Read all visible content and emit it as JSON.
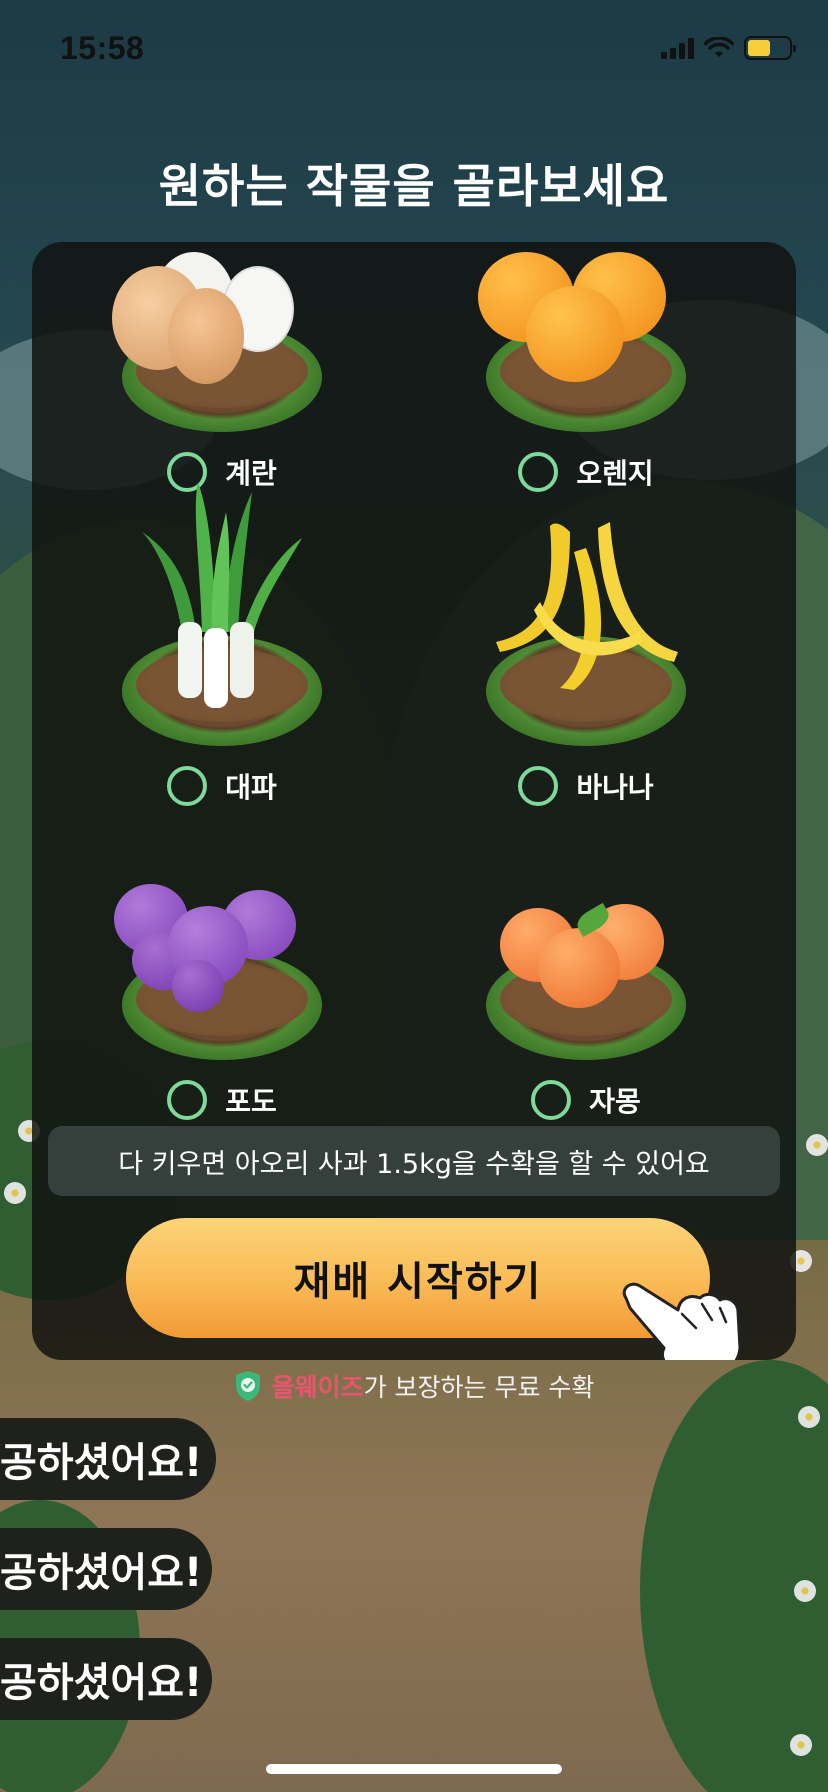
{
  "status_bar": {
    "time": "15:58",
    "battery_color": "#f5cd3d"
  },
  "page": {
    "title": "원하는 작물을 골라보세요"
  },
  "crops": [
    {
      "label": "계란",
      "icon": "egg-icon",
      "selected": false
    },
    {
      "label": "오렌지",
      "icon": "orange-icon",
      "selected": false
    },
    {
      "label": "대파",
      "icon": "green-onion-icon",
      "selected": false
    },
    {
      "label": "바나나",
      "icon": "banana-icon",
      "selected": false
    },
    {
      "label": "포도",
      "icon": "grape-icon",
      "selected": false
    },
    {
      "label": "자몽",
      "icon": "grapefruit-icon",
      "selected": false
    }
  ],
  "info": {
    "text": "다 키우면 아오리 사과 1.5kg을 수확을 할 수 있어요"
  },
  "start_button": {
    "label": "재배 시작하기"
  },
  "guarantee": {
    "brand": "올웨이즈",
    "text": "가 보장하는 무료 수확"
  },
  "toasts": [
    {
      "text": "공하셨어요!"
    },
    {
      "text": "공하셨어요!"
    },
    {
      "text": "공하셨어요!"
    }
  ],
  "colors": {
    "accent_green": "#7ed99a",
    "button": "#f9ba55",
    "brand_red": "#e8566d"
  }
}
